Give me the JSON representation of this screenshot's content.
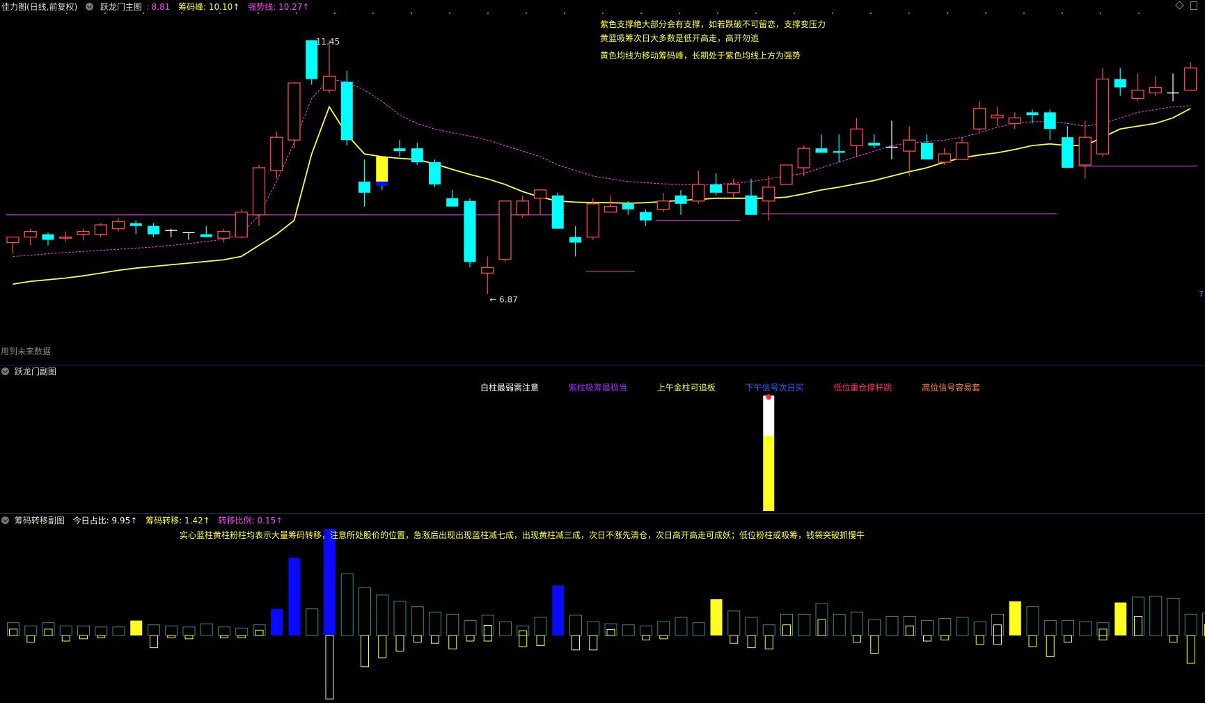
{
  "main_header": {
    "title": "佳力图(日线,前复权)",
    "panel_name": "跃龙门主图",
    "items": [
      {
        "label": ": 8.81",
        "color": "#ff40ff"
      },
      {
        "label": "筹码峰: 10.10↑",
        "color": "#ffff40"
      },
      {
        "label": "强势线: 10.27↑",
        "color": "#ff40ff"
      }
    ]
  },
  "main_notes": [
    "紫色支撑绝大部分会有支撑，如若跌破不可留恋，支撑变压力",
    "黄蓝吸筹次日大多数是低开高走，高开勿追",
    "黄色均线为移动筹码峰，长期处于紫色均线上方为强势"
  ],
  "future_data_label": "用到未来数据",
  "right_edge_label": "7",
  "sub1_header": {
    "panel_name": "跃龙门副图"
  },
  "sub1_legend": [
    {
      "label": "白柱最弱需注意",
      "color": "#ffffff"
    },
    {
      "label": "紫柱吸筹最稳当",
      "color": "#9b30ff"
    },
    {
      "label": "上午金柱可追板",
      "color": "#ffff40"
    },
    {
      "label": "下午信号次日买",
      "color": "#3060ff"
    },
    {
      "label": "低位重仓撑杆跳",
      "color": "#ff3070"
    },
    {
      "label": "高位信号容易套",
      "color": "#ff8040"
    }
  ],
  "sub2_header": {
    "panel_name": "筹码转移副图",
    "items": [
      {
        "label": "今日占比: 9.95↑",
        "color": "#ffffff"
      },
      {
        "label": "筹码转移: 1.42↑",
        "color": "#ffff40"
      },
      {
        "label": "转移比例: 0.15↑",
        "color": "#ff40ff"
      }
    ]
  },
  "sub2_note": "实心蓝柱黄柱粉柱均表示大量筹码转移，注意所处股价的位置，急涨后出现出现蓝柱减七成，出现黄柱减三成，次日不涨先清仓，次日高开高走可成妖；低位粉柱或吸筹，钱袋突破抓慢牛",
  "colors": {
    "up": "#ff4a4a",
    "down": "#00ffff",
    "ma": "#ffff40",
    "strong": "#ff40ff",
    "support": "#c040c0",
    "blue": "#0a0aff",
    "yellow": "#ffff20",
    "teal": "#2a8c8c"
  },
  "chart_data": {
    "type": "candlestick",
    "y_range": [
      6.3,
      11.9
    ],
    "annotations": [
      {
        "label": "11.45",
        "candle": 17,
        "price": 11.45
      },
      {
        "label": "6.87",
        "candle": 27,
        "price": 6.87
      }
    ],
    "candles": [
      [
        7.8,
        7.9,
        7.6,
        7.9
      ],
      [
        7.9,
        8.05,
        7.75,
        8.0
      ],
      [
        7.95,
        7.98,
        7.75,
        7.85
      ],
      [
        7.88,
        8.0,
        7.82,
        7.9
      ],
      [
        7.95,
        8.05,
        7.85,
        8.0
      ],
      [
        7.95,
        8.15,
        7.9,
        8.12
      ],
      [
        8.05,
        8.25,
        8.0,
        8.18
      ],
      [
        8.15,
        8.2,
        7.95,
        8.1
      ],
      [
        8.1,
        8.15,
        7.9,
        7.95
      ],
      [
        8.0,
        8.05,
        7.9,
        8.02
      ],
      [
        7.98,
        7.99,
        7.85,
        7.98
      ],
      [
        7.95,
        8.1,
        7.9,
        7.9
      ],
      [
        7.88,
        8.05,
        7.8,
        8.0
      ],
      [
        7.9,
        8.4,
        7.88,
        8.35
      ],
      [
        8.3,
        9.2,
        8.1,
        9.15
      ],
      [
        9.1,
        9.8,
        8.95,
        9.7
      ],
      [
        9.65,
        10.7,
        9.5,
        10.68
      ],
      [
        11.45,
        11.45,
        10.65,
        10.75
      ],
      [
        10.55,
        11.45,
        10.5,
        10.8
      ],
      [
        10.7,
        10.9,
        9.55,
        9.65
      ],
      [
        8.9,
        9.3,
        8.45,
        8.7
      ],
      [
        9.35,
        9.35,
        8.75,
        8.9
      ],
      [
        9.5,
        9.65,
        9.35,
        9.45
      ],
      [
        9.5,
        9.6,
        9.2,
        9.25
      ],
      [
        9.25,
        9.3,
        8.8,
        8.85
      ],
      [
        8.6,
        8.75,
        8.5,
        8.45
      ],
      [
        8.55,
        8.6,
        7.35,
        7.45
      ],
      [
        7.25,
        7.55,
        6.87,
        7.35
      ],
      [
        7.5,
        8.55,
        7.45,
        8.55
      ],
      [
        8.3,
        8.65,
        8.25,
        8.55
      ],
      [
        8.6,
        8.75,
        8.3,
        8.75
      ],
      [
        8.65,
        8.7,
        8.05,
        8.05
      ],
      [
        7.9,
        8.1,
        7.55,
        7.8
      ],
      [
        7.9,
        8.6,
        7.85,
        8.5
      ],
      [
        8.35,
        8.65,
        8.4,
        8.45
      ],
      [
        8.5,
        8.55,
        8.3,
        8.4
      ],
      [
        8.35,
        8.4,
        8.1,
        8.2
      ],
      [
        8.4,
        8.7,
        8.35,
        8.55
      ],
      [
        8.65,
        8.75,
        8.3,
        8.5
      ],
      [
        8.55,
        9.1,
        8.5,
        8.85
      ],
      [
        8.85,
        9.05,
        8.65,
        8.7
      ],
      [
        8.7,
        8.95,
        8.6,
        8.85
      ],
      [
        8.65,
        8.95,
        8.3,
        8.3
      ],
      [
        8.55,
        9.0,
        8.2,
        8.8
      ],
      [
        8.85,
        9.2,
        8.85,
        9.2
      ],
      [
        9.15,
        9.55,
        9.0,
        9.5
      ],
      [
        9.5,
        9.75,
        9.45,
        9.42
      ],
      [
        9.45,
        9.75,
        9.25,
        9.42
      ],
      [
        9.55,
        10.05,
        9.35,
        9.85
      ],
      [
        9.6,
        9.75,
        9.5,
        9.55
      ],
      [
        9.5,
        10.0,
        9.3,
        9.52
      ],
      [
        9.45,
        9.9,
        9.0,
        9.65
      ],
      [
        9.6,
        9.75,
        9.3,
        9.3
      ],
      [
        9.25,
        9.5,
        9.2,
        9.4
      ],
      [
        9.3,
        9.7,
        9.3,
        9.6
      ],
      [
        9.85,
        10.35,
        9.8,
        10.22
      ],
      [
        10.05,
        10.25,
        9.9,
        10.1
      ],
      [
        9.95,
        10.15,
        9.85,
        10.05
      ],
      [
        10.15,
        10.2,
        9.95,
        10.1
      ],
      [
        10.15,
        10.2,
        9.65,
        9.85
      ],
      [
        9.7,
        9.9,
        9.15,
        9.15
      ],
      [
        9.2,
        10.0,
        8.95,
        9.7
      ],
      [
        9.4,
        10.95,
        9.35,
        10.75
      ],
      [
        10.75,
        10.95,
        10.45,
        10.6
      ],
      [
        10.4,
        10.85,
        10.35,
        10.55
      ],
      [
        10.5,
        10.8,
        10.45,
        10.6
      ],
      [
        10.5,
        10.85,
        10.35,
        10.5
      ],
      [
        10.55,
        11.05,
        10.55,
        10.95
      ]
    ],
    "ma": [
      7.05,
      7.1,
      7.13,
      7.16,
      7.2,
      7.25,
      7.3,
      7.34,
      7.37,
      7.4,
      7.43,
      7.46,
      7.49,
      7.55,
      7.75,
      7.95,
      8.2,
      9.4,
      10.25,
      9.75,
      9.4,
      9.35,
      9.32,
      9.3,
      9.22,
      9.12,
      9.03,
      8.95,
      8.85,
      8.72,
      8.62,
      8.55,
      8.53,
      8.52,
      8.52,
      8.51,
      8.52,
      8.54,
      8.56,
      8.58,
      8.6,
      8.6,
      8.6,
      8.6,
      8.62,
      8.68,
      8.75,
      8.8,
      8.86,
      8.92,
      9.0,
      9.08,
      9.15,
      9.25,
      9.33,
      9.38,
      9.42,
      9.48,
      9.55,
      9.58,
      9.55,
      9.55,
      9.7,
      9.85,
      9.9,
      9.95,
      10.05,
      10.22
    ],
    "strong_line": [
      7.55,
      7.57,
      7.6,
      7.62,
      7.64,
      7.66,
      7.68,
      7.7,
      7.72,
      7.75,
      7.78,
      7.82,
      7.86,
      7.95,
      8.3,
      8.9,
      9.6,
      10.4,
      10.75,
      10.7,
      10.55,
      10.35,
      10.1,
      9.95,
      9.85,
      9.78,
      9.72,
      9.65,
      9.55,
      9.45,
      9.35,
      9.2,
      9.1,
      9.0,
      8.95,
      8.9,
      8.88,
      8.86,
      8.85,
      8.84,
      8.85,
      8.87,
      8.9,
      8.95,
      9.0,
      9.05,
      9.15,
      9.25,
      9.35,
      9.45,
      9.55,
      9.6,
      9.62,
      9.65,
      9.7,
      9.78,
      9.88,
      9.95,
      9.98,
      9.98,
      9.95,
      9.9,
      9.95,
      10.05,
      10.15,
      10.2,
      10.25,
      10.27
    ],
    "support_lines": [
      {
        "price": 8.3,
        "from": 0,
        "to": 31
      },
      {
        "price": 7.28,
        "from": 33,
        "to": 35
      },
      {
        "price": 8.2,
        "from": 37,
        "to": 41
      },
      {
        "price": 8.32,
        "from": 43,
        "to": 59
      },
      {
        "price": 9.18,
        "from": 61,
        "to": 67
      }
    ],
    "sub1_bar": {
      "candle": 43,
      "yellow": 0.6,
      "white": 0.32,
      "max": 1.0
    },
    "transfer_up": [
      0.12,
      0.09,
      0.12,
      0.09,
      0.09,
      0.08,
      0.08,
      0.14,
      0.1,
      0.09,
      0.08,
      0.11,
      0.08,
      0.07,
      0.1,
      0.25,
      0.73,
      0.25,
      1.0,
      0.58,
      0.45,
      0.38,
      0.32,
      0.27,
      0.22,
      0.2,
      0.14,
      0.19,
      0.13,
      0.09,
      0.17,
      0.47,
      0.19,
      0.13,
      0.11,
      0.1,
      0.09,
      0.13,
      0.17,
      0.12,
      0.34,
      0.23,
      0.17,
      0.1,
      0.2,
      0.2,
      0.3,
      0.2,
      0.22,
      0.15,
      0.18,
      0.18,
      0.14,
      0.16,
      0.17,
      0.13,
      0.2,
      0.32,
      0.27,
      0.14,
      0.14,
      0.13,
      0.12,
      0.31,
      0.36,
      0.37,
      0.35,
      0.2,
      0.21
    ],
    "transfer_up_style": [
      "y",
      "o",
      "y",
      "o",
      "o",
      "o",
      "o",
      "Y",
      "o",
      "o",
      "o",
      "o",
      "o",
      "o",
      "y",
      "B",
      "B",
      "o",
      "B",
      "o",
      "o",
      "o",
      "o",
      "o",
      "o",
      "o",
      "o",
      "y",
      "o",
      "y",
      "o",
      "B",
      "o",
      "o",
      "y",
      "o",
      "o",
      "o",
      "o",
      "o",
      "Y",
      "o",
      "o",
      "o",
      "y",
      "o",
      "y",
      "o",
      "o",
      "o",
      "o",
      "y",
      "o",
      "o",
      "o",
      "o",
      "y",
      "Y",
      "o",
      "o",
      "o",
      "o",
      "y",
      "Y",
      "y",
      "o",
      "o",
      "o",
      "y"
    ],
    "transfer_down": [
      0.0,
      0.06,
      0.0,
      0.05,
      0.03,
      0.02,
      0.0,
      0.0,
      0.11,
      0.02,
      0.03,
      0.0,
      0.02,
      0.02,
      0.0,
      0.0,
      0.0,
      0.0,
      0.57,
      0.0,
      0.28,
      0.2,
      0.14,
      0.06,
      0.07,
      0.12,
      0.05,
      0.05,
      0.0,
      0.1,
      0.09,
      0.0,
      0.13,
      0.13,
      0.0,
      0.0,
      0.04,
      0.03,
      0.0,
      0.0,
      0.0,
      0.07,
      0.11,
      0.12,
      0.0,
      0.0,
      0.0,
      0.0,
      0.06,
      0.16,
      0.0,
      0.0,
      0.05,
      0.04,
      0.0,
      0.08,
      0.08,
      0.0,
      0.1,
      0.19,
      0.06,
      0.0,
      0.04,
      0.0,
      0.0,
      0.0,
      0.06,
      0.25,
      0.0
    ]
  }
}
